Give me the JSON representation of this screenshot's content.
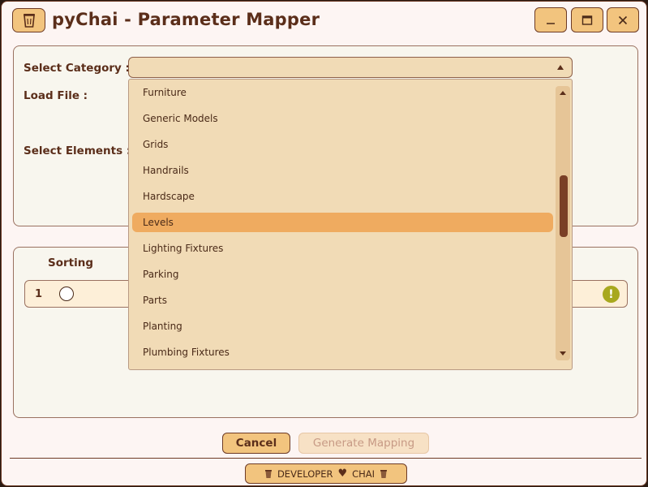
{
  "window": {
    "title": "pyChai - Parameter Mapper",
    "app_icon": "coffee-cup-icon",
    "controls": {
      "minimize": "minimize-icon",
      "maximize": "maximize-icon",
      "close": "close-icon"
    }
  },
  "form": {
    "select_category_label": "Select Category :",
    "load_file_label": "Load File :",
    "select_elements_label": "Select Elements :",
    "category_value": ""
  },
  "dropdown": {
    "items": [
      "Furniture",
      "Generic Models",
      "Grids",
      "Handrails",
      "Hardscape",
      "Levels",
      "Lighting Fixtures",
      "Parking",
      "Parts",
      "Planting",
      "Plumbing Fixtures"
    ],
    "highlighted": "Levels"
  },
  "sorting": {
    "header": "Sorting",
    "rows": [
      {
        "number": "1"
      }
    ]
  },
  "buttons": {
    "cancel": "Cancel",
    "generate": "Generate Mapping"
  },
  "footer": {
    "developer": "DEVELOPER",
    "chai": "CHAI"
  },
  "colors": {
    "accent": "#f2c47e",
    "border": "#6d3b26",
    "highlight": "#efab60",
    "warning": "#a8a81e"
  }
}
